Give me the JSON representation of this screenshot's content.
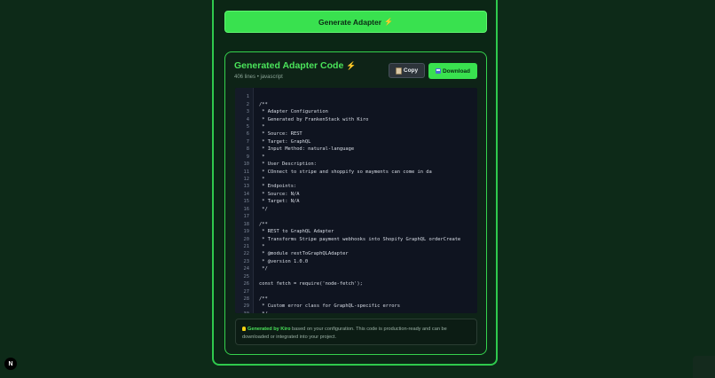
{
  "generate_button": {
    "label": "Generate Adapter",
    "icon": "bolt-icon"
  },
  "panel": {
    "title": "Generated Adapter Code",
    "title_icon": "bolt-icon",
    "lines_count": "406 lines",
    "separator": "•",
    "language": "javascript",
    "copy_label": "Copy",
    "download_label": "Download"
  },
  "code_lines": [
    {
      "n": "1",
      "t": ""
    },
    {
      "n": "2",
      "t": "/**"
    },
    {
      "n": "3",
      "t": " * Adapter Configuration"
    },
    {
      "n": "4",
      "t": " * Generated by FrankenStack with Kiro"
    },
    {
      "n": "5",
      "t": " *"
    },
    {
      "n": "6",
      "t": " * Source: REST"
    },
    {
      "n": "7",
      "t": " * Target: GraphQL"
    },
    {
      "n": "8",
      "t": " * Input Method: natural-language"
    },
    {
      "n": "9",
      "t": " *"
    },
    {
      "n": "10",
      "t": " * User Description:"
    },
    {
      "n": "11",
      "t": " * COnnect to stripe and shoppify so mayments can come in da"
    },
    {
      "n": "12",
      "t": " *"
    },
    {
      "n": "13",
      "t": " * Endpoints:"
    },
    {
      "n": "14",
      "t": " * Source: N/A"
    },
    {
      "n": "15",
      "t": " * Target: N/A"
    },
    {
      "n": "16",
      "t": " */"
    },
    {
      "n": "17",
      "t": ""
    },
    {
      "n": "18",
      "t": "/**"
    },
    {
      "n": "19",
      "t": " * REST to GraphQL Adapter"
    },
    {
      "n": "20",
      "t": " * Transforms Stripe payment webhooks into Shopify GraphQL orderCreate"
    },
    {
      "n": "21",
      "t": " *"
    },
    {
      "n": "22",
      "t": " * @module restToGraphQLAdapter"
    },
    {
      "n": "23",
      "t": " * @version 1.0.0"
    },
    {
      "n": "24",
      "t": " */"
    },
    {
      "n": "25",
      "t": ""
    },
    {
      "n": "26",
      "t": "const fetch = require('node-fetch');"
    },
    {
      "n": "27",
      "t": ""
    },
    {
      "n": "28",
      "t": "/**"
    },
    {
      "n": "29",
      "t": " * Custom error class for GraphQL-specific errors"
    },
    {
      "n": "30",
      "t": " */"
    }
  ],
  "note": {
    "highlight": "Generated by Kiro",
    "text_1": " based on your configuration. This code is production-ready and can be",
    "text_2": "downloaded or integrated into your project."
  },
  "badge": {
    "label": "N"
  },
  "colors": {
    "accent": "#39e14f",
    "background": "#0d2a18",
    "code_bg": "#0f1420"
  }
}
